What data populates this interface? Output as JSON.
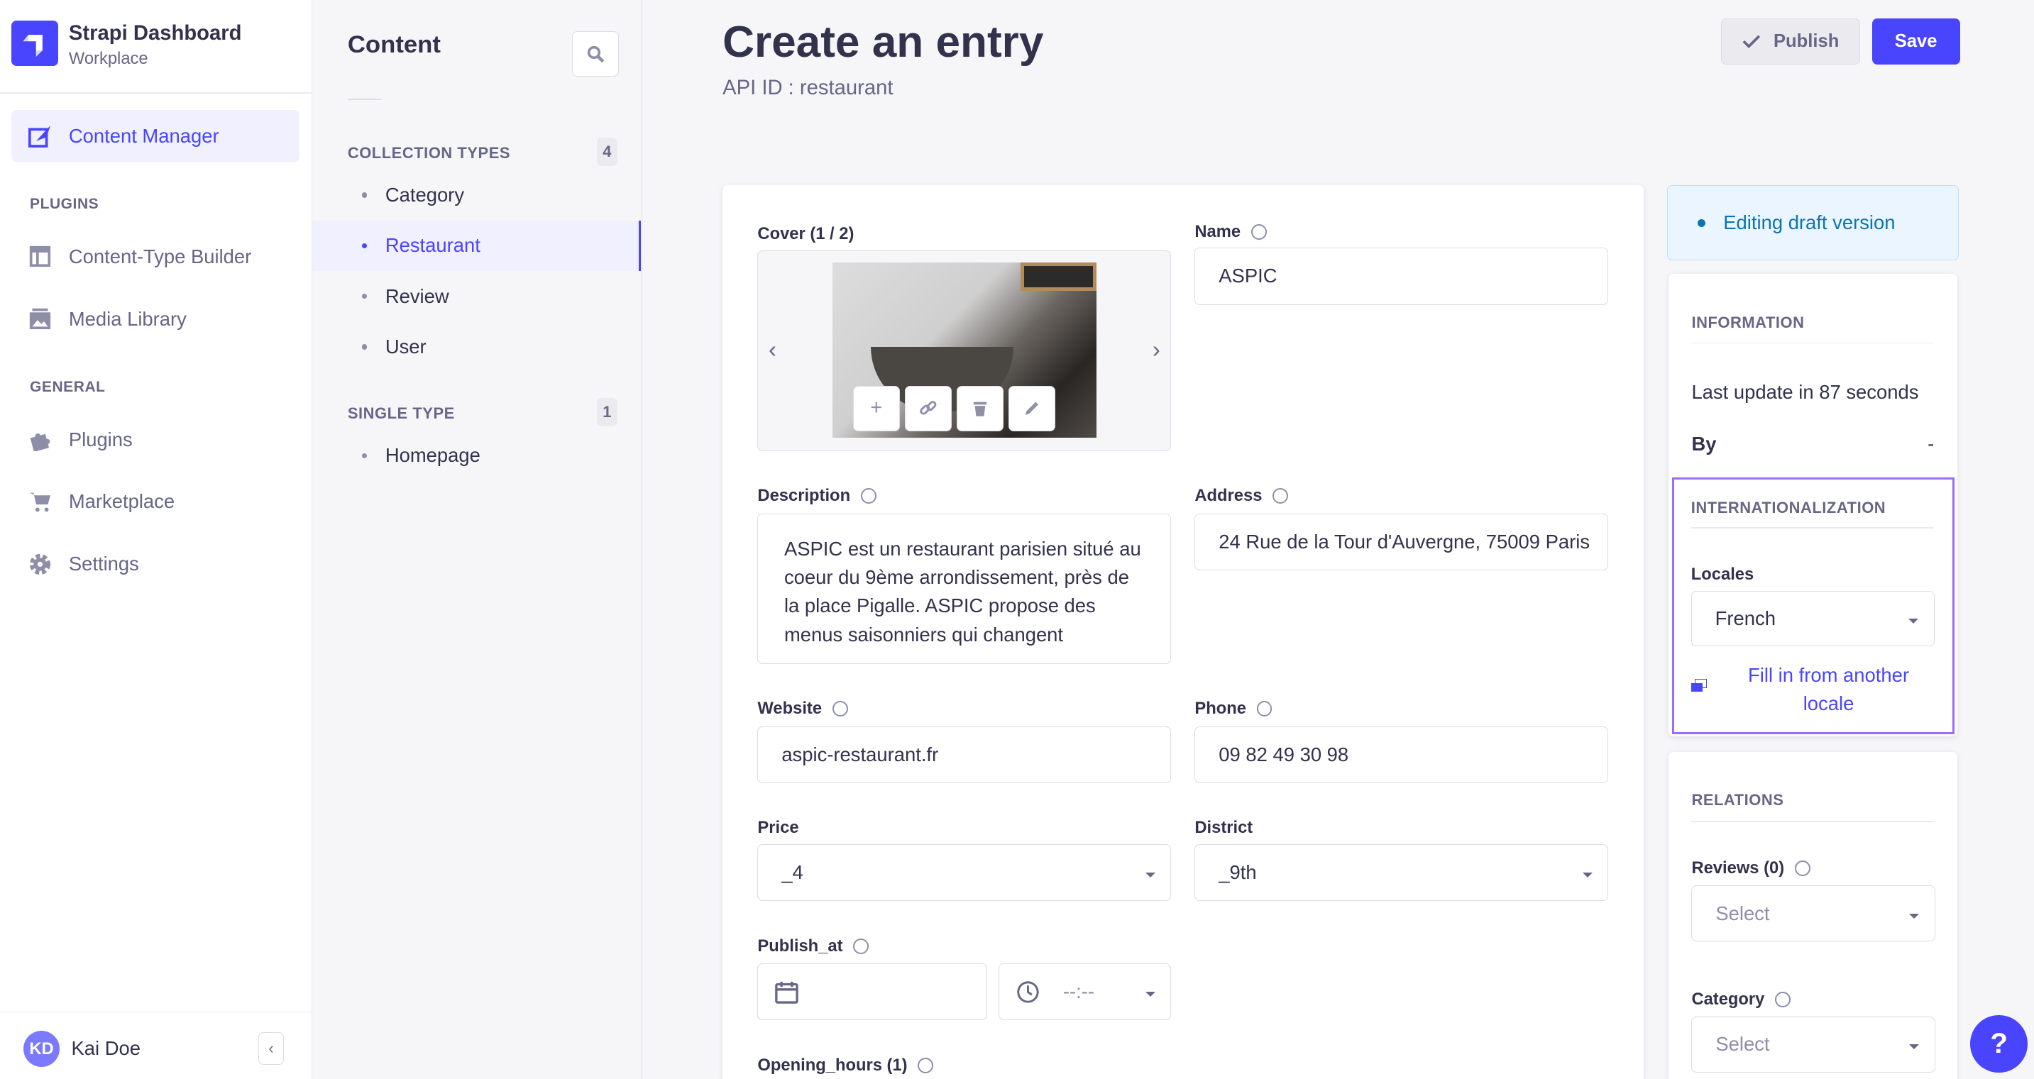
{
  "sidebar": {
    "brand_title": "Strapi Dashboard",
    "brand_subtitle": "Workplace",
    "content_manager": "Content Manager",
    "plugins_header": "PLUGINS",
    "plugins_items": [
      {
        "label": "Content-Type Builder",
        "icon": "layout-icon"
      },
      {
        "label": "Media Library",
        "icon": "image-icon"
      }
    ],
    "general_header": "GENERAL",
    "general_items": [
      {
        "label": "Plugins",
        "icon": "puzzle-icon"
      },
      {
        "label": "Marketplace",
        "icon": "cart-icon"
      },
      {
        "label": "Settings",
        "icon": "gear-icon"
      }
    ],
    "user": {
      "initials": "KD",
      "name": "Kai Doe"
    }
  },
  "subnav": {
    "title": "Content",
    "collection_header": "COLLECTION TYPES",
    "collection_count": "4",
    "collection_items": [
      "Category",
      "Restaurant",
      "Review",
      "User"
    ],
    "single_header": "SINGLE TYPE",
    "single_count": "1",
    "single_items": [
      "Homepage"
    ]
  },
  "header": {
    "title": "Create an entry",
    "api_id": "API ID : restaurant",
    "publish": "Publish",
    "save": "Save"
  },
  "form": {
    "cover_label": "Cover (1 / 2)",
    "name_label": "Name",
    "name_value": "ASPIC",
    "description_label": "Description",
    "description_value": "ASPIC est un restaurant parisien situé au coeur du 9ème arrondissement, près de la place Pigalle. ASPIC propose des menus saisonniers qui changent",
    "address_label": "Address",
    "address_value": "24 Rue de la Tour d'Auvergne, 75009 Paris",
    "website_label": "Website",
    "website_value": "aspic-restaurant.fr",
    "phone_label": "Phone",
    "phone_value": "09 82 49 30 98",
    "price_label": "Price",
    "price_value": "_4",
    "district_label": "District",
    "district_value": "_9th",
    "publish_at_label": "Publish_at",
    "time_placeholder": "--:--",
    "opening_hours_label": "Opening_hours (1)"
  },
  "right": {
    "status": "Editing draft version",
    "info_header": "INFORMATION",
    "last_update": "Last update in 87 seconds",
    "by_label": "By",
    "by_value": "-",
    "i18n_header": "INTERNATIONALIZATION",
    "locales_label": "Locales",
    "locale_value": "French",
    "fill_link": "Fill in from another locale",
    "relations_header": "RELATIONS",
    "reviews_label": "Reviews (0)",
    "reviews_placeholder": "Select",
    "category_label": "Category",
    "category_placeholder": "Select"
  },
  "help": "?",
  "colors": {
    "primary": "#4945ff",
    "highlight": "#9c6cf9",
    "draft_bg": "#eaf5ff",
    "draft_text": "#0c75af"
  }
}
